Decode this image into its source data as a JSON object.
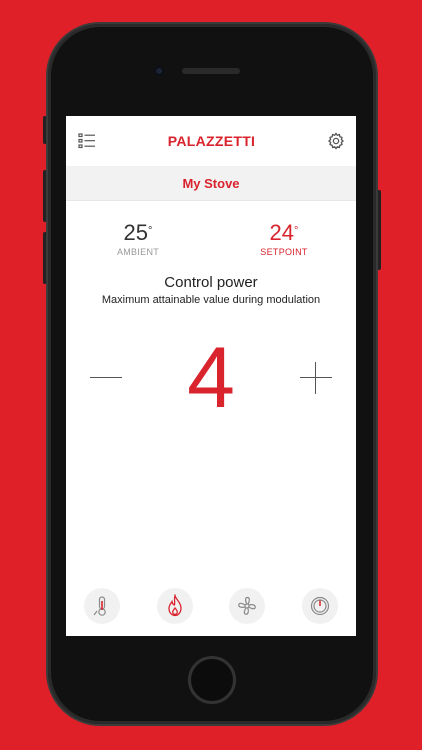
{
  "app": {
    "brand": "PALAZZETTI",
    "stove_name": "My Stove"
  },
  "temps": {
    "ambient_value": "25",
    "ambient_label": "AMBIENT",
    "setpoint_value": "24",
    "setpoint_label": "SETPOINT",
    "degree_symbol": "°"
  },
  "control": {
    "title": "Control power",
    "subtitle": "Maximum attainable value during modulation",
    "value": "4"
  },
  "icons": {
    "menu": "list-menu-icon",
    "settings": "gear-icon",
    "thermometer": "thermometer-icon",
    "flame": "flame-icon",
    "fan": "fan-icon",
    "gauge": "gauge-icon"
  },
  "colors": {
    "brand_red": "#d9232d",
    "background_red": "#e02028"
  }
}
